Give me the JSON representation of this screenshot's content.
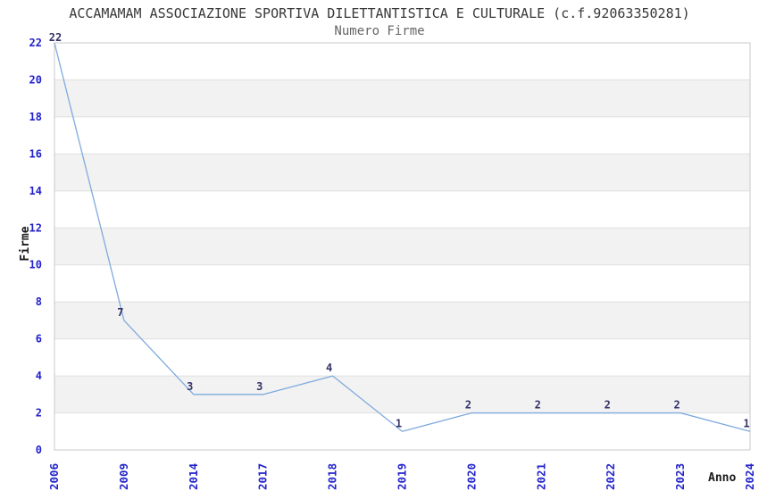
{
  "chart_data": {
    "type": "line",
    "title": "ACCAMAMAM ASSOCIAZIONE SPORTIVA DILETTANTISTICA E CULTURALE (c.f.92063350281)",
    "subtitle": "Numero Firme",
    "xlabel": "Anno",
    "ylabel": "Firme",
    "categories": [
      "2006",
      "2009",
      "2014",
      "2017",
      "2018",
      "2019",
      "2020",
      "2021",
      "2022",
      "2023",
      "2024"
    ],
    "values": [
      22,
      7,
      3,
      3,
      4,
      1,
      2,
      2,
      2,
      2,
      1
    ],
    "ylim": [
      0,
      22
    ],
    "ytick_step": 2,
    "grid": "horizontal",
    "band_fill": "alternating",
    "legend": false,
    "markers": false,
    "colors": {
      "line": "#7faade",
      "tick_label": "#2222cc",
      "data_label": "#333369",
      "band": "#f2f2f2",
      "gridline": "#e0e0e0",
      "border": "#c8c8c8",
      "title": "#383838",
      "subtitle": "#666666",
      "axis_label": "#1a1a1a",
      "background": "#ffffff"
    }
  }
}
